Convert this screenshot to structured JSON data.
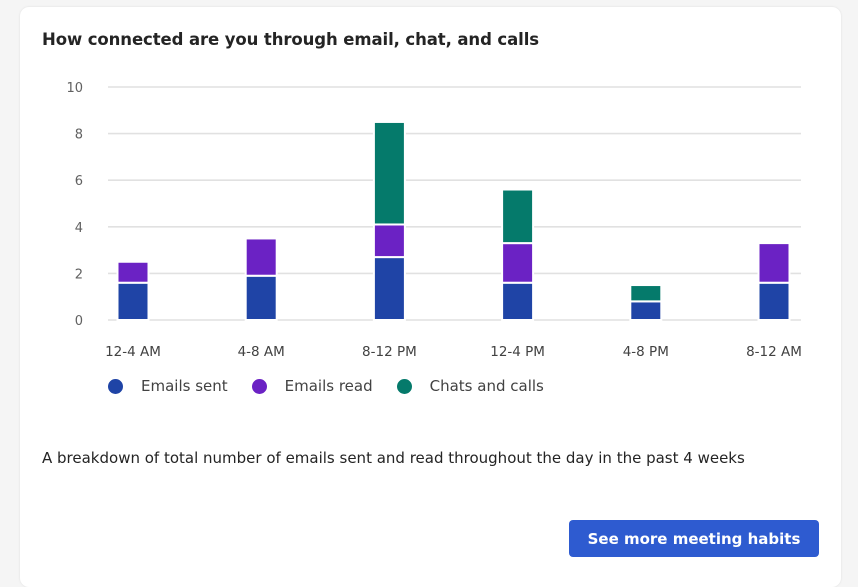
{
  "card": {
    "title": "How connected are you through email, chat, and calls",
    "description": "A breakdown of total number of emails sent and read throughout the day in the past 4 weeks",
    "cta_label": "See more meeting habits",
    "cta_color": "#2e5bd0"
  },
  "chart_data": {
    "type": "bar",
    "stacked": true,
    "title": "How connected are you through email, chat, and calls",
    "xlabel": "",
    "ylabel": "",
    "ylim": [
      0,
      10
    ],
    "yticks": [
      0,
      2,
      4,
      6,
      8,
      10
    ],
    "grid": true,
    "legend_position": "bottom-left",
    "categories": [
      "12-4 AM",
      "4-8 AM",
      "8-12 PM",
      "12-4 PM",
      "4-8 PM",
      "8-12 AM"
    ],
    "series": [
      {
        "name": "Emails sent",
        "color": "#1f44a6",
        "values": [
          1.6,
          1.9,
          2.7,
          1.6,
          0.8,
          1.6
        ]
      },
      {
        "name": "Emails read",
        "color": "#6b22c4",
        "values": [
          0.9,
          1.6,
          1.4,
          1.7,
          0,
          1.7
        ]
      },
      {
        "name": "Chats and calls",
        "color": "#057a6b",
        "values": [
          0,
          0,
          4.4,
          2.3,
          0.7,
          0
        ]
      }
    ]
  }
}
